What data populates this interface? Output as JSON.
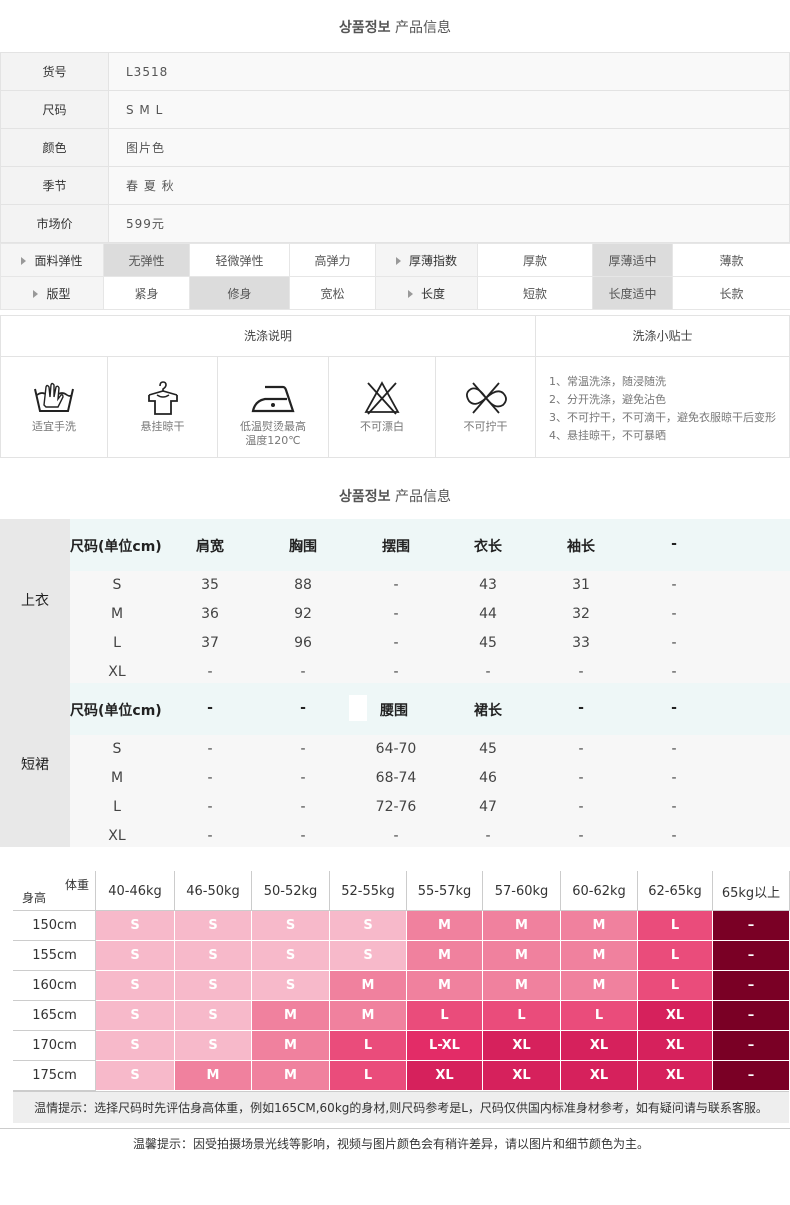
{
  "section1": {
    "title_bold": "상품정보",
    "title_sub": " 产品信息"
  },
  "info": [
    {
      "label": "货号",
      "value": "L3518"
    },
    {
      "label": "尺码",
      "value": "S   M   L"
    },
    {
      "label": "颜色",
      "value": "图片色"
    },
    {
      "label": "季节",
      "value": "春  夏  秋"
    },
    {
      "label": "市场价",
      "value": "599元"
    }
  ],
  "attrs": {
    "row1": {
      "label1": "面料弹性",
      "opts1": [
        "无弹性",
        "轻微弹性",
        "高弹力"
      ],
      "selected1": "无弹性",
      "label2": "厚薄指数",
      "opts2": [
        "厚款",
        "厚薄适中",
        "薄款"
      ],
      "selected2": "厚薄适中"
    },
    "row2": {
      "label1": "版型",
      "opts1": [
        "紧身",
        "修身",
        "宽松"
      ],
      "selected1": "修身",
      "label2": "长度",
      "opts2": [
        "短款",
        "长度适中",
        "长款"
      ],
      "selected2": "长度适中"
    }
  },
  "wash": {
    "title": "洗涤说明",
    "tips_title": "洗涤小贴士",
    "icons": [
      {
        "icon": "hand-wash-icon",
        "label": "适宜手洗"
      },
      {
        "icon": "hang-dry-icon",
        "label": "悬挂晾干"
      },
      {
        "icon": "low-iron-icon",
        "label": "低温熨烫最高\n温度120℃"
      },
      {
        "icon": "no-bleach-icon",
        "label": "不可漂白"
      },
      {
        "icon": "no-wring-icon",
        "label": "不可拧干"
      }
    ],
    "tips": [
      "1、常温洗涤，随浸随洗",
      "2、分开洗涤，避免沾色",
      "3、不可拧干，不可滴干，避免衣服晾干后变形",
      "4、悬挂晾干，不可暴晒"
    ]
  },
  "section2": {
    "title_bold": "상품정보",
    "title_sub": " 产品信息"
  },
  "size_table": {
    "top": {
      "side_label": "上衣",
      "header": [
        "尺码(单位cm)",
        "肩宽",
        "胸围",
        "摆围",
        "衣长",
        "袖长",
        "-"
      ],
      "rows": [
        [
          "S",
          "35",
          "88",
          "-",
          "43",
          "31",
          "-"
        ],
        [
          "M",
          "36",
          "92",
          "-",
          "44",
          "32",
          "-"
        ],
        [
          "L",
          "37",
          "96",
          "-",
          "45",
          "33",
          "-"
        ],
        [
          "XL",
          "-",
          "-",
          "-",
          "-",
          "-",
          "-"
        ]
      ]
    },
    "skirt": {
      "side_label": "短裙",
      "header": [
        "尺码(单位cm)",
        "-",
        "-",
        "腰围",
        "裙长",
        "-",
        "-"
      ],
      "rows": [
        [
          "S",
          "-",
          "-",
          "64-70",
          "45",
          "-",
          "-"
        ],
        [
          "M",
          "-",
          "-",
          "68-74",
          "46",
          "-",
          "-"
        ],
        [
          "L",
          "-",
          "-",
          "72-76",
          "47",
          "-",
          "-"
        ],
        [
          "XL",
          "-",
          "-",
          "-",
          "-",
          "-",
          "-"
        ]
      ]
    }
  },
  "height_weight": {
    "corner_weight": "体重",
    "corner_height": "身高",
    "weights": [
      "40-46kg",
      "46-50kg",
      "50-52kg",
      "52-55kg",
      "55-57kg",
      "57-60kg",
      "60-62kg",
      "62-65kg",
      "65kg以上"
    ],
    "rows": [
      {
        "height": "150cm",
        "sizes": [
          "S",
          "S",
          "S",
          "S",
          "M",
          "M",
          "M",
          "L",
          "–"
        ]
      },
      {
        "height": "155cm",
        "sizes": [
          "S",
          "S",
          "S",
          "S",
          "M",
          "M",
          "M",
          "L",
          "–"
        ]
      },
      {
        "height": "160cm",
        "sizes": [
          "S",
          "S",
          "S",
          "M",
          "M",
          "M",
          "M",
          "L",
          "–"
        ]
      },
      {
        "height": "165cm",
        "sizes": [
          "S",
          "S",
          "M",
          "M",
          "L",
          "L",
          "L",
          "XL",
          "–"
        ]
      },
      {
        "height": "170cm",
        "sizes": [
          "S",
          "S",
          "M",
          "L",
          "L-XL",
          "XL",
          "XL",
          "XL",
          "–"
        ]
      },
      {
        "height": "175cm",
        "sizes": [
          "S",
          "M",
          "M",
          "L",
          "XL",
          "XL",
          "XL",
          "XL",
          "–"
        ]
      }
    ],
    "colors": {
      "S": "#f7b9ca",
      "M": "#f0819e",
      "L": "#ea4c7b",
      "L-XL": "#e32c67",
      "XL": "#d6215c",
      "–": "#7a0025"
    },
    "note": "温情提示：选择尺码时先评估身高体重，例如165CM,60kg的身材,则尺码参考是L，尺码仅供国内标准身材参考，如有疑问请与联系客服。"
  },
  "footer_note": "温馨提示：因受拍摄场景光线等影响，视频与图片颜色会有稍许差异，请以图片和细节颜色为主。"
}
